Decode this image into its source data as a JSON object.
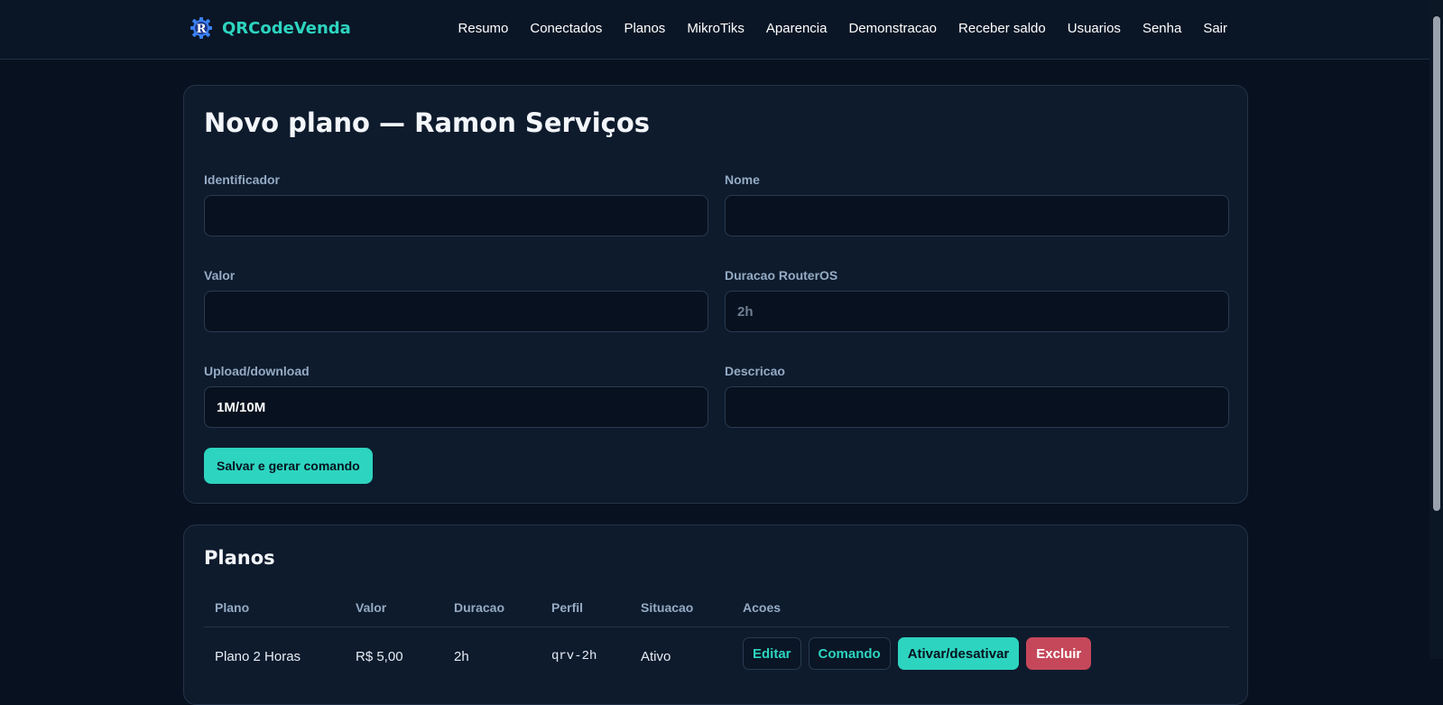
{
  "brand": {
    "name": "QRCodeVenda",
    "logo_letter": "R",
    "logo_icon": "gear-r-logo-icon",
    "accent_color": "#2dd4bf"
  },
  "nav": {
    "items": [
      "Resumo",
      "Conectados",
      "Planos",
      "MikroTiks",
      "Aparencia",
      "Demonstracao",
      "Receber saldo",
      "Usuarios",
      "Senha",
      "Sair"
    ]
  },
  "form": {
    "title": "Novo plano — Ramon Serviços",
    "fields": {
      "identificador": {
        "label": "Identificador",
        "value": "",
        "placeholder": ""
      },
      "nome": {
        "label": "Nome",
        "value": "",
        "placeholder": ""
      },
      "valor": {
        "label": "Valor",
        "value": "",
        "placeholder": ""
      },
      "duracao": {
        "label": "Duracao RouterOS",
        "value": "",
        "placeholder": "2h"
      },
      "upload_download": {
        "label": "Upload/download",
        "value": "1M/10M",
        "placeholder": ""
      },
      "descricao": {
        "label": "Descricao",
        "value": "",
        "placeholder": ""
      }
    },
    "submit_label": "Salvar e gerar comando"
  },
  "plans": {
    "title": "Planos",
    "columns": [
      "Plano",
      "Valor",
      "Duracao",
      "Perfil",
      "Situacao",
      "Acoes"
    ],
    "rows": [
      {
        "plano": "Plano 2 Horas",
        "valor": "R$ 5,00",
        "duracao": "2h",
        "perfil": "qrv-2h",
        "situacao": "Ativo",
        "actions": [
          "Editar",
          "Comando",
          "Ativar/desativar",
          "Excluir"
        ]
      }
    ]
  },
  "colors": {
    "background": "#08111f",
    "card": "#0e1b2d",
    "danger": "#c5485a"
  }
}
